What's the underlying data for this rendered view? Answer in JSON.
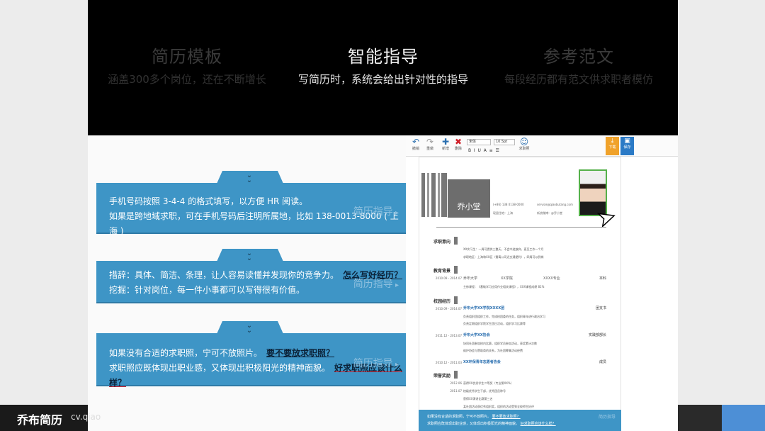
{
  "features": [
    {
      "title": "简历模板",
      "subtitle": "涵盖300多个岗位，还在不断增长"
    },
    {
      "title": "智能指导",
      "subtitle": "写简历时，系统会给出针对性的指导"
    },
    {
      "title": "参考范文",
      "subtitle": "每段经历都有范文供求职者模仿"
    }
  ],
  "tips": [
    {
      "line1": "手机号码按照 3-4-4 的格式填写，以方便 HR 阅读。",
      "line2": "如果是跨地域求职，可在手机号码后注明所属地，比如 138-0013-8000 ( 上海 )",
      "guide": "简历指导"
    },
    {
      "line1": "措辞：具体、简洁、条理，让人容易读懂并发现你的竞争力。",
      "link1": "怎么写好经历？",
      "line2": "挖掘：针对岗位，每一件小事都可以写得很有价值。",
      "guide": "简历指导"
    },
    {
      "line1": "如果没有合适的求职照，宁可不放照片。",
      "link1": "要不要放求职照？",
      "line2": "求职照应既体现出职业感，又体现出积极阳光的精神面貌。",
      "link2": "好求职照应该什么样？",
      "guide": "简历指导"
    }
  ],
  "editor": {
    "toolbar": {
      "undo": "撤销",
      "redo": "重做",
      "add": "新增",
      "delete": "删除",
      "font": "宋体",
      "size": "10.5pt",
      "avatar": "求职照",
      "save": "下载",
      "print": "保存"
    },
    "resume": {
      "name": "乔小堂",
      "phone": "(+86) 138 0138-0000",
      "email": "service@qiaobutang.com",
      "location": "现居住地：上海",
      "weibo": "新浪微博：@乔小堂",
      "sections": {
        "intent": "求职意向",
        "education": "教育背景",
        "campus": "校园经历",
        "awards": "荣誉奖励"
      },
      "intent_lines": [
        "XX实习生：一周可提供三整天，不会中途放弃，直至工作一个月",
        "求职地区：上海和XX区（需离公司近交通便利），四周可以到岗"
      ],
      "edu": {
        "date": "2010.09 - 2014.07",
        "school": "乔布大学",
        "college": "XX学院",
        "major": "XXXX专业",
        "degree": "本科",
        "line": "主修课程：《基础学习应用作业相关课程》，XXX课程成绩 81%"
      },
      "campus": [
        {
          "date": "2010.09 - 2014.07",
          "org": "乔布大学XX学院XXXX团",
          "role": "团支书",
          "lines": [
            "负责组织团组织工作，完成校团委的任务，组织青年进行政治学习",
            "负责定期组织学院学生团日活动，组织学习比赛等"
          ]
        },
        {
          "date": "2011.12 - 2013.07",
          "org": "乔布大学XX协会",
          "role": "实践部部长",
          "lines": [
            "协同社团参加校内比赛，组织学员参加活动，获奖累计次数",
            "维护协会与赞助商的关系，为社团筹集活动经费"
          ]
        },
        {
          "date": "2010.12 - 2011.03",
          "org": "XX环保青年志愿者协会",
          "role": "成员",
          "lines": []
        }
      ],
      "awards": [
        {
          "date": "2012.06",
          "text": "获得XX优秀学生二等奖（专业第XX%）"
        },
        {
          "date": "2011.07",
          "text": "校级优秀学生干部，优秀团员称号"
        },
        {
          "date": "",
          "text": "获得XX演讲比赛第三名"
        },
        {
          "date": "",
          "text": "某社团活动获优秀组织奖，组织的活动受到全校师生好评"
        }
      ]
    },
    "minitip": {
      "line1": "如果没有合适的求职照，宁可不放照片。",
      "link1": "要不要放求职照？",
      "line2": "求职照应既体现出职业感，又体现出积极阳光的精神面貌。",
      "link2": "好求职照应该什么样？",
      "guide": "简历指导"
    }
  },
  "footer": {
    "brand": "乔布简历",
    "url": "cv.qiao"
  }
}
